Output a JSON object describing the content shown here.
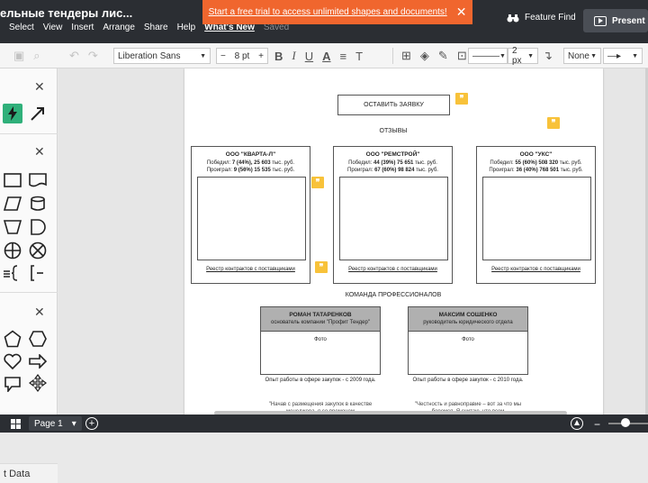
{
  "header": {
    "doc_title": "ельные тендеры лис...",
    "menu": [
      "Select",
      "View",
      "Insert",
      "Arrange",
      "Share",
      "Help",
      "What's New",
      "Saved"
    ],
    "trial_text": "Start a free trial to access unlimited shapes and documents!",
    "feature_find": "Feature Find",
    "present": "Present"
  },
  "toolbar": {
    "font": "Liberation Sans",
    "font_size": "8 pt",
    "line_width": "2 px",
    "arrow_start": "None",
    "minus": "−",
    "plus": "+",
    "bold": "B",
    "italic": "I",
    "underline": "U",
    "font_color": "A",
    "text_opts": "T"
  },
  "left_panel": {
    "data_label": "t Data"
  },
  "page": {
    "apply_button": "ОСТАВИТЬ ЗАЯВКУ",
    "reviews_label": "ОТЗЫВЫ",
    "team_label": "КОМАНДА ПРОФЕССИОНАЛОВ",
    "cards": [
      {
        "company": "ООО \"КВАРТА-Л\"",
        "wins_label": "Победил:",
        "wins_value": "7 (44%), 25 603",
        "wins_unit": "тыс. руб.",
        "losses_label": "Проиграл:",
        "losses_value": "9 (56%) 15 535",
        "losses_unit": "тыс. руб.",
        "registry": "Реестр контрактов с поставщиками"
      },
      {
        "company": "ООО \"РЕМСТРОЙ\"",
        "wins_label": "Победил:",
        "wins_value": "44 (39%) 75 651",
        "wins_unit": "тыс. руб.",
        "losses_label": "Проиграл:",
        "losses_value": "67 (60%) 98 824",
        "losses_unit": "тыс. руб.",
        "registry": "Реестр контрактов с поставщиками"
      },
      {
        "company": "ООО \"УКС\"",
        "wins_label": "Победил:",
        "wins_value": "55 (60%) 508 320",
        "wins_unit": "тыс. руб.",
        "losses_label": "Проиграл:",
        "losses_value": "36 (40%) 768 501",
        "losses_unit": "тыс. руб.",
        "registry": "Реестр контрактов с поставщиками"
      }
    ],
    "team": [
      {
        "name": "РОМАН ТАТАРЕНКОВ",
        "role": "основатель компании \"Профит Тендер\"",
        "photo": "Фото",
        "experience": "Опыт работы в сфере закупок - с 2009 года.",
        "quote": "\"Начав с размещения закупок в качестве менеджера, я со временем"
      },
      {
        "name": "МАКСИМ СОШЕНКО",
        "role": "руководитель юридического отдела",
        "photo": "Фото",
        "experience": "Опыт работы в сфере закупок - с 2010 года.",
        "quote": "\"Честность и равноправие – вот за что мы боремся. Я считаю, что всем"
      }
    ]
  },
  "bottom_bar": {
    "page_tab": "Page 1",
    "dropdown_glyph": "▾",
    "add_glyph": "+",
    "zoom_minus": "−"
  },
  "colors": {
    "header_bg": "#2b2e33",
    "trial_orange": "#f0662e",
    "quote_yellow": "#f8c23a",
    "accent_green": "#2fb07a"
  }
}
